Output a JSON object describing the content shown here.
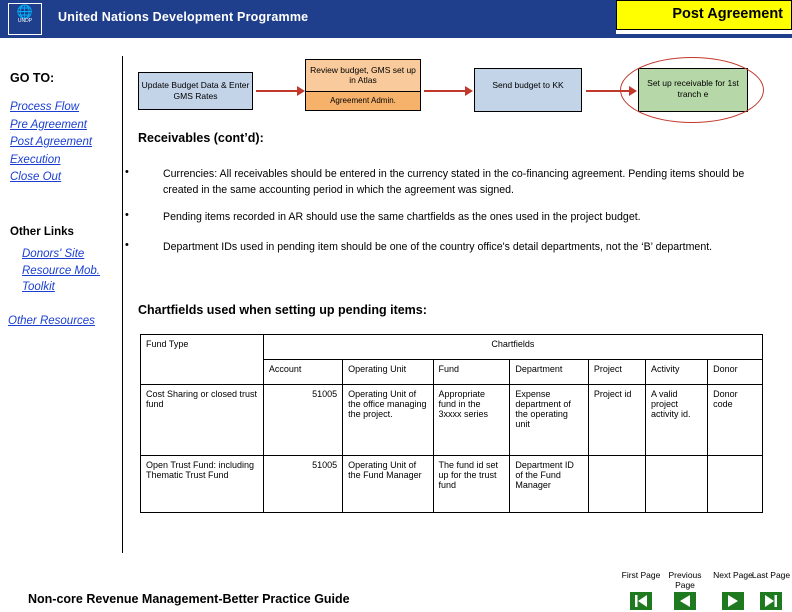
{
  "header": {
    "org": "United Nations Development Programme",
    "logo_text": "UNDP",
    "tab_label": "Post Agreement"
  },
  "nav": {
    "goto_label": "GO TO:",
    "items": [
      {
        "label": "Process Flow"
      },
      {
        "label": "Pre Agreement"
      },
      {
        "label": "Post Agreement"
      },
      {
        "label": "Execution"
      },
      {
        "label": "Close Out"
      }
    ],
    "other_links_label": "Other Links",
    "other_links": [
      {
        "label": "Donors' Site"
      },
      {
        "label": "Resource Mob."
      },
      {
        "label": "Toolkit"
      }
    ],
    "other_resources": "Other Resources"
  },
  "flow": {
    "box1": "Update Budget Data & Enter GMS Rates",
    "box2_top": "Review budget, GMS set up in Atlas",
    "box2_bottom": "Agreement Admin.",
    "box3": "Send budget to KK",
    "box4": "Set up receivable for 1st tranch e"
  },
  "main": {
    "section_title": "Receivables (cont’d):",
    "bullets": [
      "Currencies: All receivables should be entered in the currency stated in the co-financing agreement. Pending items should  be created in the same accounting period in which the agreement was signed.",
      "Pending items recorded in AR should use the same chartfields as the ones used in the project budget.",
      "Department IDs used in pending item should be one of the country office's detail departments, not the ‘B’ department."
    ],
    "table_title": "Chartfields used when setting up pending items:"
  },
  "table": {
    "header_left": "Fund Type",
    "header_group": "Chartfields",
    "columns": [
      "Account",
      "Operating Unit",
      "Fund",
      "Department",
      "Project",
      "Activity",
      "Donor"
    ],
    "rows": [
      {
        "fund_type": "Cost Sharing or closed trust fund",
        "account": "51005",
        "operating_unit": "Operating Unit of the office managing the project.",
        "fund": "Appropriate fund in the 3xxxx series",
        "department": "Expense department of the operating unit",
        "project": "Project id",
        "activity": "A valid project activity id.",
        "donor": "Donor code"
      },
      {
        "fund_type": "Open Trust Fund: including Thematic Trust Fund",
        "account": "51005",
        "operating_unit": "Operating Unit of the Fund Manager",
        "fund": "The fund id set up for the trust fund",
        "department": "Department ID of the Fund Manager",
        "project": "",
        "activity": "",
        "donor": ""
      }
    ]
  },
  "footer": {
    "title": "Non-core Revenue Management-Better Practice Guide",
    "nav": [
      {
        "label": "First Page",
        "icon": "first-page-icon"
      },
      {
        "label": "Previous Page",
        "icon": "previous-page-icon"
      },
      {
        "label": "Next Page",
        "icon": "next-page-icon"
      },
      {
        "label": "Last Page",
        "icon": "last-page-icon"
      }
    ]
  }
}
